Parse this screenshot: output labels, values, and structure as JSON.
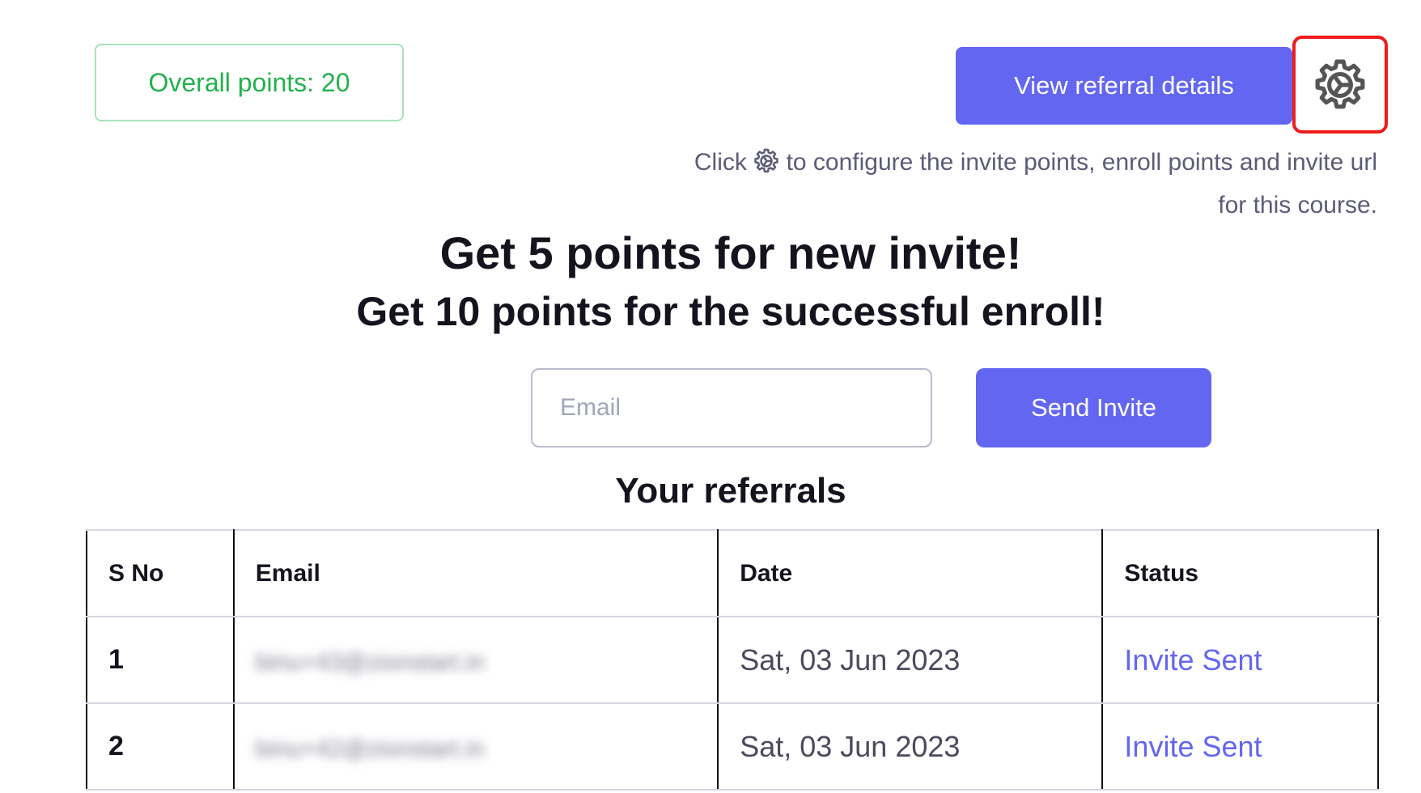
{
  "points": {
    "label": "Overall points: 20"
  },
  "header": {
    "view_button": "View referral details",
    "settings_icon": "gear-icon"
  },
  "hint": {
    "prefix": "Click",
    "suffix": "to configure the invite points, enroll points and invite url for this course."
  },
  "headlines": {
    "invite": "Get 5 points for new invite!",
    "enroll": "Get 10 points for the successful enroll!"
  },
  "invite_form": {
    "email_placeholder": "Email",
    "send_button": "Send Invite"
  },
  "referrals": {
    "title": "Your referrals",
    "columns": [
      "S No",
      "Email",
      "Date",
      "Status"
    ],
    "rows": [
      {
        "sno": "1",
        "email": "binu+43@zionstart.in",
        "date": "Sat, 03 Jun 2023",
        "status": "Invite Sent"
      },
      {
        "sno": "2",
        "email": "binu+42@zionstart.in",
        "date": "Sat, 03 Jun 2023",
        "status": "Invite Sent"
      }
    ]
  },
  "colors": {
    "accent": "#6366f1",
    "points_green": "#22b14c",
    "highlight_red": "#ee1c1c"
  }
}
